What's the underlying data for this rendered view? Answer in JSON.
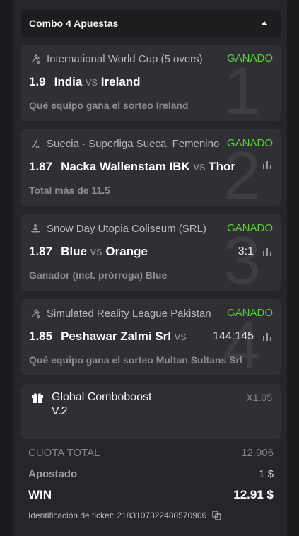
{
  "combo": {
    "title": "Combo 4 Apuestas"
  },
  "bets": [
    {
      "number": "1",
      "sport_icon": "cricket-icon",
      "tournament": "International World Cup (5 overs)",
      "status": "GANADO",
      "odd": "1.9",
      "home": "India",
      "vs": "vs",
      "away": "Ireland",
      "score": "",
      "selection": "Qué equipo gana el sorteo Ireland"
    },
    {
      "number": "2",
      "sport_icon": "hockey-icon",
      "tournament": "Suecia · Superliga Sueca, Femenino",
      "status": "GANADO",
      "odd": "1.87",
      "home": "Nacka Wallenstam IBK",
      "vs": "vs",
      "away": "Thor",
      "score": "",
      "selection": "Total más de 11.5"
    },
    {
      "number": "3",
      "sport_icon": "snowboard-icon",
      "tournament": "Snow Day Utopia Coliseum (SRL)",
      "status": "GANADO",
      "odd": "1.87",
      "home": "Blue",
      "vs": "vs",
      "away": "Orange",
      "score": "3:1",
      "selection": "Ganador (incl. prórroga) Blue"
    },
    {
      "number": "4",
      "sport_icon": "cricket-icon",
      "tournament": "Simulated Reality League Pakistan",
      "status": "GANADO",
      "odd": "1.85",
      "home": "Peshawar Zalmi Srl",
      "vs": "vs",
      "away": "",
      "score": "144:145",
      "selection": "Qué equipo gana el sorteo Multan Sultans Srl"
    }
  ],
  "boost": {
    "name": "Global Comboboost V.2",
    "multiplier": "X1.05",
    "icon": "gift-icon"
  },
  "summary": {
    "total_odds_label": "CUOTA TOTAL",
    "total_odds_value": "12.906",
    "staked_label": "Apostado",
    "staked_value": "1 $",
    "win_label": "WIN",
    "win_value": "12.91 $"
  },
  "ticket": {
    "label": "Identificación de ticket:",
    "id": "2183107322480570906"
  },
  "colors": {
    "status_green": "#5bd23a",
    "background": "#1a1a1c",
    "card": "#2f2f34"
  }
}
